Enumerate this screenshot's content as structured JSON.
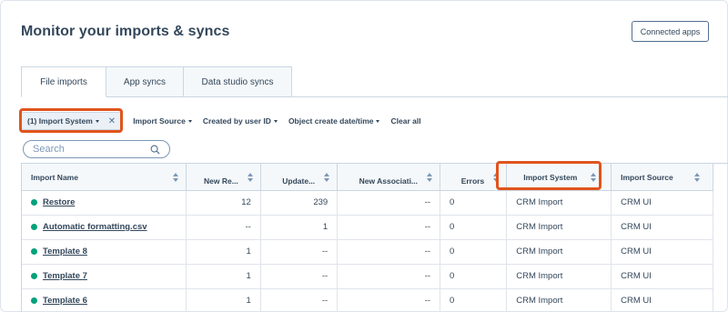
{
  "page": {
    "title": "Monitor your imports & syncs"
  },
  "header": {
    "connected_apps_label": "Connected apps"
  },
  "tabs": [
    {
      "label": "File imports",
      "active": true
    },
    {
      "label": "App syncs",
      "active": false
    },
    {
      "label": "Data studio syncs",
      "active": false
    }
  ],
  "filters": {
    "active_chip_label": "(1) Import System",
    "dropdowns": [
      "Import Source",
      "Created by user ID",
      "Object create date/time"
    ],
    "clear_all_label": "Clear all"
  },
  "search": {
    "placeholder": "Search"
  },
  "table": {
    "columns": [
      "Import Name",
      "New Re...",
      "Update...",
      "New Associati...",
      "Errors",
      "Import System",
      "Import Source"
    ],
    "rows": [
      {
        "name": "Restore",
        "new_records": "12",
        "updated": "239",
        "new_associations": "--",
        "errors": "0",
        "import_system": "CRM Import",
        "import_source": "CRM UI"
      },
      {
        "name": "Automatic formatting.csv",
        "new_records": "--",
        "updated": "1",
        "new_associations": "--",
        "errors": "0",
        "import_system": "CRM Import",
        "import_source": "CRM UI"
      },
      {
        "name": "Template 8",
        "new_records": "1",
        "updated": "--",
        "new_associations": "--",
        "errors": "0",
        "import_system": "CRM Import",
        "import_source": "CRM UI"
      },
      {
        "name": "Template 7",
        "new_records": "1",
        "updated": "--",
        "new_associations": "--",
        "errors": "0",
        "import_system": "CRM Import",
        "import_source": "CRM UI"
      },
      {
        "name": "Template 6",
        "new_records": "1",
        "updated": "--",
        "new_associations": "--",
        "errors": "0",
        "import_system": "CRM Import",
        "import_source": "CRM UI"
      }
    ]
  },
  "colors": {
    "highlight": "#e0541d",
    "status_dot": "#00a27a",
    "text": "#33475b"
  },
  "icons": [
    "search-icon",
    "close-icon",
    "sort-icon",
    "caret-down-icon",
    "status-dot-icon"
  ]
}
